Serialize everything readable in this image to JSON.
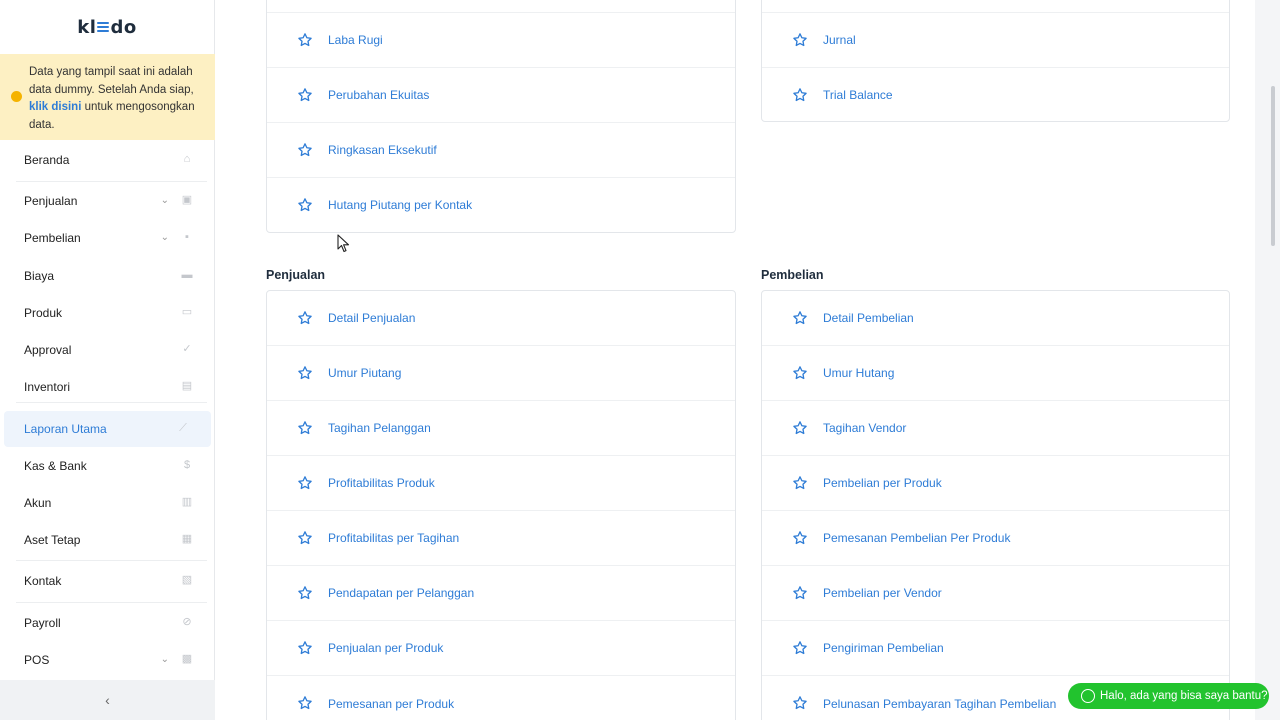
{
  "logo": {
    "left": "kl",
    "right": "do"
  },
  "notice": {
    "text_before": "Data yang tampil saat ini adalah data dummy. Setelah Anda siap, ",
    "link": "klik disini",
    "text_after": " untuk mengosongkan data."
  },
  "sidebar": {
    "items": [
      {
        "label": "Beranda",
        "icon": "home-icon",
        "chevron": false,
        "active": false
      },
      {
        "label": "Penjualan",
        "icon": "basket-icon",
        "chevron": true,
        "active": false
      },
      {
        "label": "Pembelian",
        "icon": "bag-icon",
        "chevron": true,
        "active": false
      },
      {
        "label": "Biaya",
        "icon": "card-icon",
        "chevron": false,
        "active": false
      },
      {
        "label": "Produk",
        "icon": "box-icon",
        "chevron": false,
        "active": false
      },
      {
        "label": "Approval",
        "icon": "check-icon",
        "chevron": false,
        "active": false
      },
      {
        "label": "Inventori",
        "icon": "briefcase-icon",
        "chevron": false,
        "active": false
      },
      {
        "label": "Laporan Utama",
        "icon": "chart-icon",
        "chevron": false,
        "active": true
      },
      {
        "label": "Kas & Bank",
        "icon": "dollar-icon",
        "chevron": false,
        "active": false
      },
      {
        "label": "Akun",
        "icon": "ledger-icon",
        "chevron": false,
        "active": false
      },
      {
        "label": "Aset Tetap",
        "icon": "building-icon",
        "chevron": false,
        "active": false
      },
      {
        "label": "Kontak",
        "icon": "contact-card-icon",
        "chevron": false,
        "active": false
      },
      {
        "label": "Payroll",
        "icon": "check-circle-icon",
        "chevron": false,
        "active": false
      },
      {
        "label": "POS",
        "icon": "pos-icon",
        "chevron": true,
        "active": false
      }
    ],
    "collapse_glyph": "‹"
  },
  "reports": {
    "top_left": [
      "Laba Rugi",
      "Perubahan Ekuitas",
      "Ringkasan Eksekutif",
      "Hutang Piutang per Kontak"
    ],
    "top_right": [
      "Jurnal",
      "Trial Balance"
    ],
    "sales": {
      "title": "Penjualan",
      "items": [
        "Detail Penjualan",
        "Umur Piutang",
        "Tagihan Pelanggan",
        "Profitabilitas Produk",
        "Profitabilitas per Tagihan",
        "Pendapatan per Pelanggan",
        "Penjualan per Produk",
        "Pemesanan per Produk"
      ]
    },
    "purchases": {
      "title": "Pembelian",
      "items": [
        "Detail Pembelian",
        "Umur Hutang",
        "Tagihan Vendor",
        "Pembelian per Produk",
        "Pemesanan Pembelian Per Produk",
        "Pembelian per Vendor",
        "Pengiriman Pembelian",
        "Pelunasan Pembayaran Tagihan Pembelian"
      ]
    }
  },
  "chat": {
    "label": "Halo, ada yang bisa saya bantu?"
  },
  "colors": {
    "accent": "#2e7cd6",
    "notice_bg": "#fdf0c3",
    "chat": "#22c32e"
  }
}
